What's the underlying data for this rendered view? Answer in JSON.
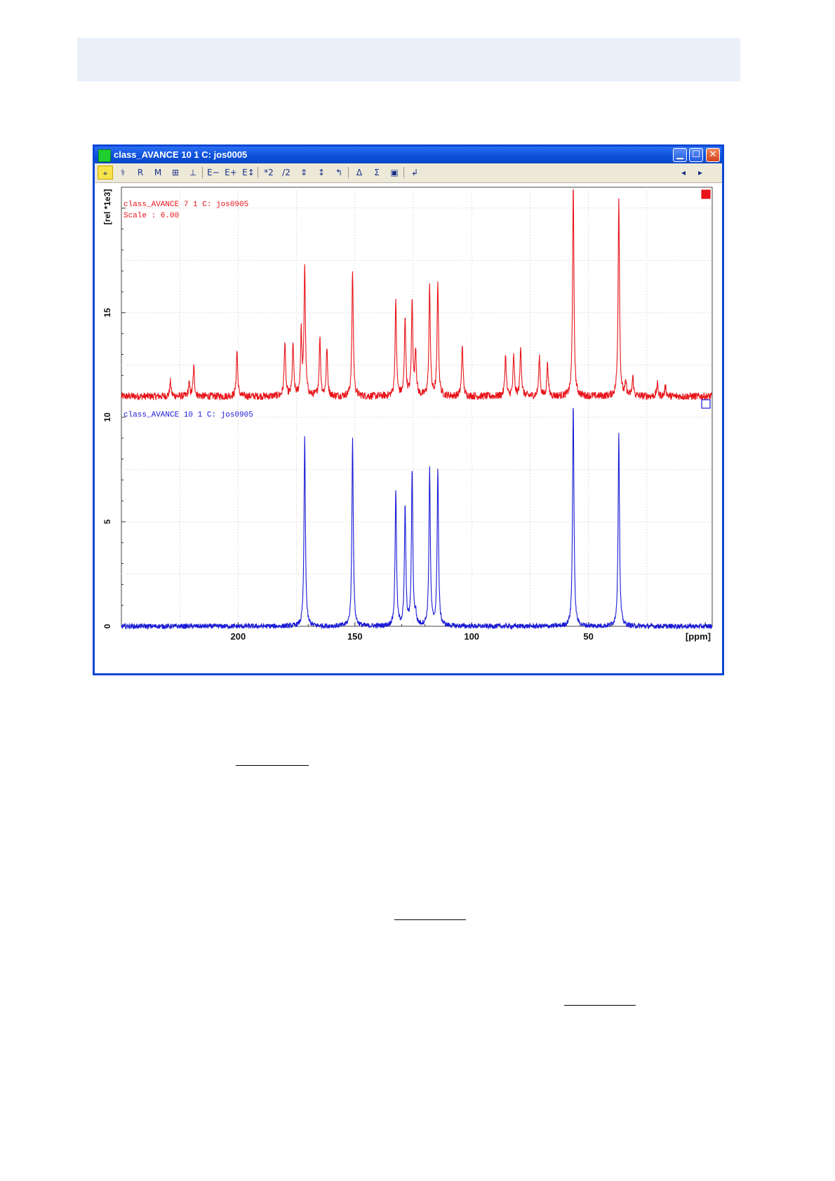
{
  "window": {
    "title": "class_AVANCE 10 1 C: jos0005"
  },
  "toolbar": {
    "buttons": [
      {
        "name": "crosshair-tool",
        "glyph": "⌖",
        "active": true
      },
      {
        "name": "phase-tool",
        "glyph": "⚕",
        "active": false
      },
      {
        "name": "reset-tool",
        "glyph": "R",
        "active": false
      },
      {
        "name": "integrate-tool",
        "glyph": "M",
        "active": false
      },
      {
        "name": "baseline-tool",
        "glyph": "⊞",
        "active": false
      },
      {
        "name": "peak-tool",
        "glyph": "⊥",
        "active": false
      },
      {
        "name": "zoom-out-e",
        "glyph": "E−",
        "active": false
      },
      {
        "name": "zoom-in-e",
        "glyph": "E+",
        "active": false
      },
      {
        "name": "zoom-e",
        "glyph": "E↕",
        "active": false
      },
      {
        "name": "scale-up",
        "glyph": "*2",
        "active": false
      },
      {
        "name": "scale-down",
        "glyph": "/2",
        "active": false
      },
      {
        "name": "shift-both",
        "glyph": "⇕",
        "active": false
      },
      {
        "name": "shift-down",
        "glyph": "↕",
        "active": false
      },
      {
        "name": "shift-up",
        "glyph": "↰",
        "active": false
      },
      {
        "name": "delta",
        "glyph": "Δ",
        "active": false
      },
      {
        "name": "sum",
        "glyph": "Σ",
        "active": false
      },
      {
        "name": "save",
        "glyph": "▣",
        "active": false
      },
      {
        "name": "return",
        "glyph": "↲",
        "active": false
      }
    ],
    "nav_left": "◂",
    "nav_right": "▸"
  },
  "chart_data": {
    "type": "line",
    "title": "",
    "xlabel": "[ppm]",
    "ylabel": "[rel *1e3]",
    "x_axis_reversed": true,
    "xlim": [
      250,
      -3
    ],
    "ylim": [
      0,
      21
    ],
    "x_ticks": [
      200,
      150,
      100,
      50
    ],
    "y_ticks": [
      0,
      5,
      10,
      15
    ],
    "grid": true,
    "series": [
      {
        "name": "class_AVANCE 7 1 C: jos0905",
        "label_lines": [
          "class_AVANCE  7  1  C:  jos0905",
          "Scale : 6.00"
        ],
        "color": "#e8141a",
        "baseline": 11,
        "noise": 0.18,
        "peaks": [
          {
            "x": 229,
            "h": 0.7
          },
          {
            "x": 221,
            "h": 0.6
          },
          {
            "x": 219,
            "h": 1.4
          },
          {
            "x": 200.5,
            "h": 2.2
          },
          {
            "x": 180,
            "h": 2.6
          },
          {
            "x": 176.5,
            "h": 2.5
          },
          {
            "x": 173,
            "h": 3.0
          },
          {
            "x": 171.5,
            "h": 6.2
          },
          {
            "x": 165,
            "h": 2.8
          },
          {
            "x": 162,
            "h": 2.3
          },
          {
            "x": 151,
            "h": 6.0
          },
          {
            "x": 132.5,
            "h": 4.5
          },
          {
            "x": 128.5,
            "h": 3.8
          },
          {
            "x": 125.5,
            "h": 4.5
          },
          {
            "x": 124,
            "h": 2.2
          },
          {
            "x": 118,
            "h": 5.3
          },
          {
            "x": 114.5,
            "h": 5.5
          },
          {
            "x": 104,
            "h": 2.5
          },
          {
            "x": 85.5,
            "h": 2.0
          },
          {
            "x": 82,
            "h": 1.9
          },
          {
            "x": 79,
            "h": 2.4
          },
          {
            "x": 71,
            "h": 1.9
          },
          {
            "x": 67.5,
            "h": 1.6
          },
          {
            "x": 56.5,
            "h": 10.0
          },
          {
            "x": 37,
            "h": 9.5
          },
          {
            "x": 34,
            "h": 0.6
          },
          {
            "x": 31,
            "h": 0.9
          },
          {
            "x": 20.5,
            "h": 0.6
          },
          {
            "x": 17,
            "h": 0.5
          }
        ]
      },
      {
        "name": "class_AVANCE 10 1 C: jos0905",
        "label_lines": [
          "class_AVANCE  10  1  C:  jos0905"
        ],
        "color": "#1a1ad6",
        "baseline": 0,
        "noise": 0.12,
        "peaks": [
          {
            "x": 171.5,
            "h": 9.0
          },
          {
            "x": 151,
            "h": 9.0
          },
          {
            "x": 132.5,
            "h": 6.5
          },
          {
            "x": 128.5,
            "h": 5.7
          },
          {
            "x": 125.5,
            "h": 7.4
          },
          {
            "x": 124,
            "h": 0.5
          },
          {
            "x": 118,
            "h": 7.5
          },
          {
            "x": 114.5,
            "h": 7.5
          },
          {
            "x": 56.5,
            "h": 10.7
          },
          {
            "x": 37,
            "h": 9.2
          }
        ]
      }
    ]
  }
}
